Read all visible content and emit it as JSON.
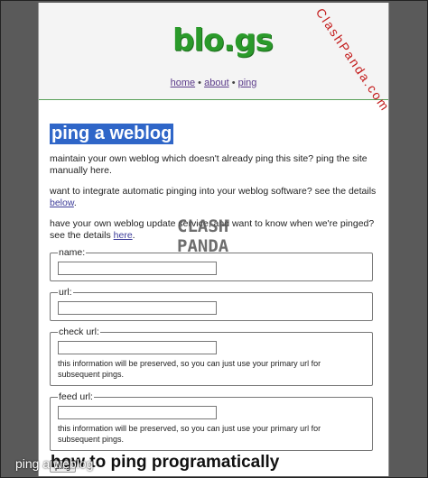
{
  "logo": {
    "text": "blo.gs"
  },
  "nav": {
    "home": "home",
    "about": "about",
    "ping": "ping",
    "sep": "•"
  },
  "main": {
    "title": "ping a weblog",
    "para1": "maintain your own weblog which doesn't already ping this site? ping the site manually here.",
    "para2_prefix": "want to integrate automatic pinging into your weblog software? see the details ",
    "para2_link": "below",
    "para2_suffix": ".",
    "para3_prefix": "have your own weblog update service, and want to know when we're pinged? see the details ",
    "para3_link": "here",
    "para3_suffix": "."
  },
  "form": {
    "name_label": "name:",
    "url_label": "url:",
    "check_url_label": "check url:",
    "check_url_hint": "this information will be preserved, so you can just use your primary url for subsequent pings.",
    "feed_url_label": "feed url:",
    "feed_url_hint": "this information will be preserved, so you can just use your primary url for subsequent pings.",
    "name_value": "",
    "url_value": "",
    "check_url_value": "",
    "feed_url_value": "",
    "submit_label": "ping"
  },
  "section2": {
    "title": "how to ping programatically"
  },
  "overlay": {
    "caption": "ping a weblog",
    "watermark_diag": "ClashPanda.com",
    "watermark_line1": "CLASH",
    "watermark_line2": "PANDA"
  },
  "colors": {
    "logo": "#2a9a2a",
    "title_highlight": "#2f66c8",
    "link": "#5b3b8a",
    "watermark": "#c31b1b"
  }
}
